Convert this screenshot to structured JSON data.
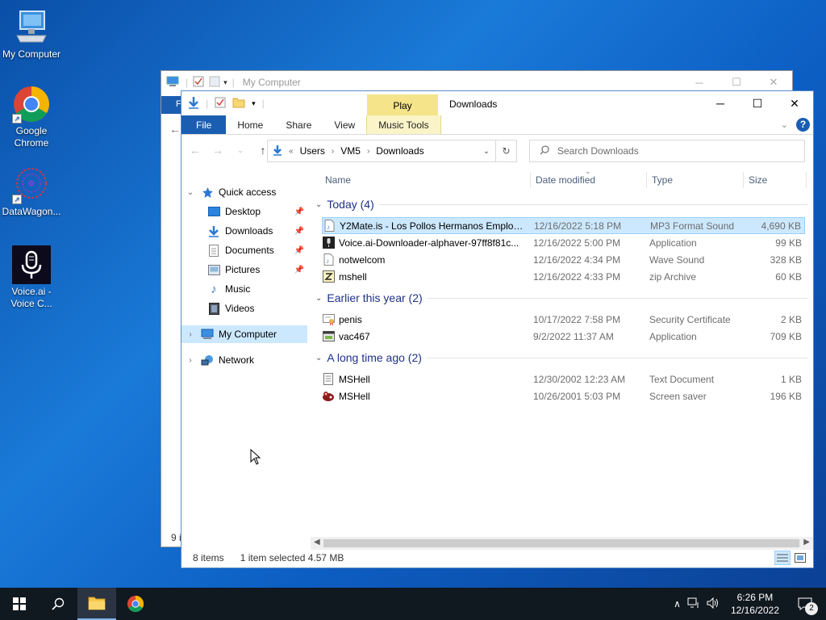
{
  "desktop": {
    "icons": [
      {
        "label": "My Computer"
      },
      {
        "label": "Google Chrome"
      },
      {
        "label": "DataWagon..."
      },
      {
        "label": "Voice.ai - Voice C..."
      }
    ]
  },
  "back_window": {
    "title": "My Computer",
    "file_tab": "F",
    "status": "9 i"
  },
  "window": {
    "title": "Downloads",
    "context_tab": "Play",
    "ribbon_tabs": [
      "File",
      "Home",
      "Share",
      "View",
      "Music Tools"
    ],
    "breadcrumb": {
      "prefix": "«",
      "parts": [
        "Users",
        "VM5",
        "Downloads"
      ]
    },
    "search_placeholder": "Search Downloads",
    "nav": {
      "quick_access": "Quick access",
      "items": [
        "Desktop",
        "Downloads",
        "Documents",
        "Pictures",
        "Music",
        "Videos"
      ],
      "my_computer": "My Computer",
      "network": "Network"
    },
    "columns": {
      "name": "Name",
      "date": "Date modified",
      "type": "Type",
      "size": "Size"
    },
    "groups": [
      {
        "label": "Today (4)",
        "files": [
          {
            "name": "Y2Mate.is - Los Pollos Hermanos Employ...",
            "date": "12/16/2022 5:18 PM",
            "type": "MP3 Format Sound",
            "size": "4,690 KB",
            "icon": "audio-icon"
          },
          {
            "name": "Voice.ai-Downloader-alphaver-97ff8f81c...",
            "date": "12/16/2022 5:00 PM",
            "type": "Application",
            "size": "99 KB",
            "icon": "voiceai-app-icon"
          },
          {
            "name": "notwelcom",
            "date": "12/16/2022 4:34 PM",
            "type": "Wave Sound",
            "size": "328 KB",
            "icon": "audio-icon"
          },
          {
            "name": "mshell",
            "date": "12/16/2022 4:33 PM",
            "type": "zip Archive",
            "size": "60 KB",
            "icon": "zip-icon"
          }
        ]
      },
      {
        "label": "Earlier this year (2)",
        "files": [
          {
            "name": "penis",
            "date": "10/17/2022 7:58 PM",
            "type": "Security Certificate",
            "size": "2 KB",
            "icon": "certificate-icon"
          },
          {
            "name": "vac467",
            "date": "9/2/2022 11:37 AM",
            "type": "Application",
            "size": "709 KB",
            "icon": "app-icon"
          }
        ]
      },
      {
        "label": "A long time ago (2)",
        "files": [
          {
            "name": "MSHell",
            "date": "12/30/2002 12:23 AM",
            "type": "Text Document",
            "size": "1 KB",
            "icon": "text-doc-icon"
          },
          {
            "name": "MSHell",
            "date": "10/26/2001 5:03 PM",
            "type": "Screen saver",
            "size": "196 KB",
            "icon": "screensaver-icon"
          }
        ]
      }
    ],
    "status": {
      "count": "8 items",
      "selection": "1 item selected  4.57 MB"
    }
  },
  "taskbar": {
    "time": "6:26 PM",
    "date": "12/16/2022",
    "notifications": "2"
  },
  "colors": {
    "accent": "#1a5eb2",
    "selection": "#cce8ff",
    "context_tab": "#f5e48a",
    "taskbar": "#101820"
  }
}
